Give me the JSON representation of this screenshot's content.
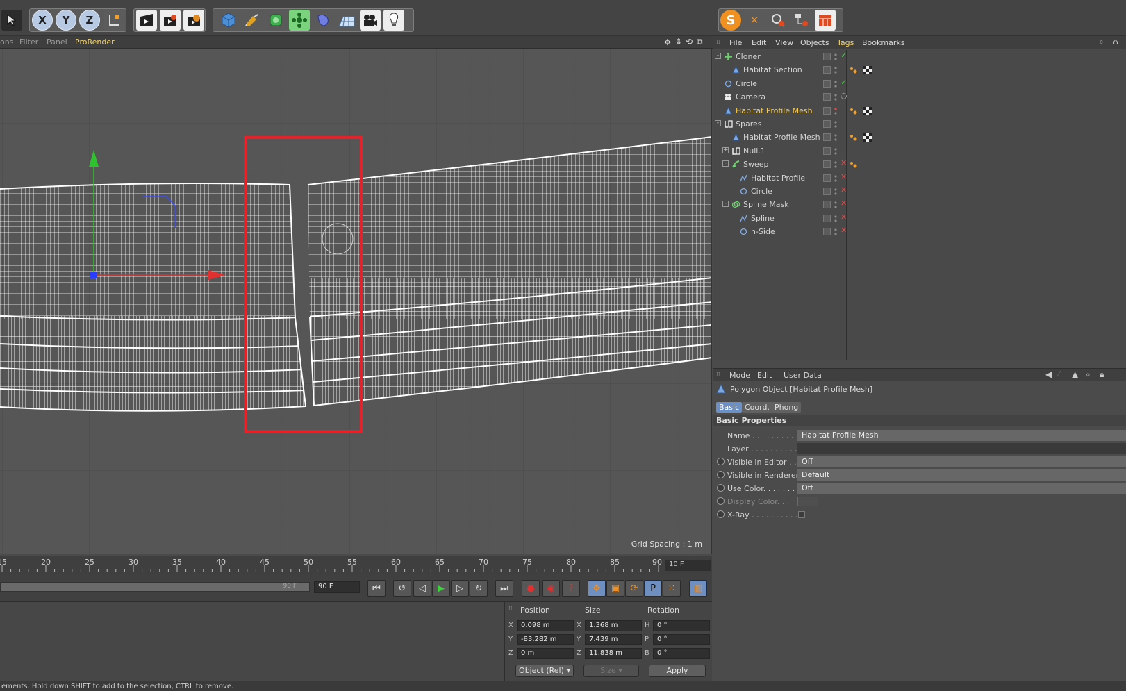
{
  "viewport": {
    "menus": [
      "ons",
      "Filter",
      "Panel",
      "ProRender"
    ],
    "active_menu": "ProRender",
    "grid_spacing": "Grid Spacing : 1 m"
  },
  "timeline": {
    "ticks": [
      "15",
      "20",
      "25",
      "30",
      "35",
      "40",
      "45",
      "50",
      "55",
      "60",
      "65",
      "70",
      "75",
      "80",
      "85",
      "90"
    ],
    "current_frame": "10 F",
    "end_frame_slider": "90 F",
    "end_frame_field": "90 F"
  },
  "coordinates": {
    "headers": {
      "position": "Position",
      "size": "Size",
      "rotation": "Rotation"
    },
    "rows": [
      {
        "axis": "X",
        "position": "0.098 m",
        "size_axis": "X",
        "size": "1.368 m",
        "rot_axis": "H",
        "rotation": "0 °"
      },
      {
        "axis": "Y",
        "position": "-83.282 m",
        "size_axis": "Y",
        "size": "7.439 m",
        "rot_axis": "P",
        "rotation": "0 °"
      },
      {
        "axis": "Z",
        "position": "0 m",
        "size_axis": "Z",
        "size": "11.838 m",
        "rot_axis": "B",
        "rotation": "0 °"
      }
    ],
    "mode_dropdown": "Object (Rel)",
    "size_dropdown": "Size",
    "apply_label": "Apply"
  },
  "status_text": "ements. Hold down SHIFT to add to the selection, CTRL to remove.",
  "object_manager": {
    "menus": [
      "File",
      "Edit",
      "View",
      "Objects",
      "Tags",
      "Bookmarks"
    ],
    "active_menu": "Tags",
    "objects": [
      {
        "name": "Cloner",
        "depth": 0,
        "expand": "-",
        "icon": "cloner",
        "status": "check",
        "tags": []
      },
      {
        "name": "Habitat Section",
        "depth": 1,
        "expand": "",
        "icon": "polygon",
        "status": "",
        "tags": [
          "phong",
          "texture"
        ]
      },
      {
        "name": "Circle",
        "depth": 0,
        "expand": "",
        "icon": "circle",
        "status": "check",
        "tags": []
      },
      {
        "name": "Camera",
        "depth": 0,
        "expand": "",
        "icon": "camera",
        "status": "target",
        "tags": []
      },
      {
        "name": "Habitat Profile Mesh",
        "depth": 0,
        "expand": "",
        "icon": "polygon",
        "status": "",
        "tags": [
          "phong",
          "texture"
        ],
        "selected": true
      },
      {
        "name": "Spares",
        "depth": 0,
        "expand": "-",
        "icon": "null",
        "status": "",
        "tags": []
      },
      {
        "name": "Habitat Profile Mesh",
        "depth": 1,
        "expand": "",
        "icon": "polygon",
        "status": "",
        "tags": [
          "phong",
          "texture"
        ]
      },
      {
        "name": "Null.1",
        "depth": 1,
        "expand": "+",
        "icon": "null",
        "status": "",
        "tags": []
      },
      {
        "name": "Sweep",
        "depth": 1,
        "expand": "-",
        "icon": "sweep",
        "status": "x",
        "tags": [
          "phong"
        ]
      },
      {
        "name": "Habitat Profile",
        "depth": 2,
        "expand": "",
        "icon": "spline",
        "status": "x",
        "tags": []
      },
      {
        "name": "Circle",
        "depth": 2,
        "expand": "",
        "icon": "circle",
        "status": "x",
        "tags": []
      },
      {
        "name": "Spline Mask",
        "depth": 1,
        "expand": "-",
        "icon": "splinemask",
        "status": "x",
        "tags": []
      },
      {
        "name": "Spline",
        "depth": 2,
        "expand": "",
        "icon": "spline",
        "status": "x",
        "tags": []
      },
      {
        "name": "n-Side",
        "depth": 2,
        "expand": "",
        "icon": "circle",
        "status": "x",
        "tags": []
      }
    ]
  },
  "attributes": {
    "menus": [
      "Mode",
      "Edit",
      "User Data"
    ],
    "title": "Polygon Object [Habitat Profile Mesh]",
    "tabs": [
      "Basic",
      "Coord.",
      "Phong"
    ],
    "active_tab": "Basic",
    "section": "Basic Properties",
    "rows": [
      {
        "label": "Name . . . . . . . . . . . .",
        "value": "Habitat Profile Mesh",
        "radio": false,
        "style": "field"
      },
      {
        "label": "Layer . . . . . . . . . . . .",
        "value": "",
        "radio": false,
        "style": "dark"
      },
      {
        "label": "Visible in Editor . .",
        "value": "Off",
        "radio": true,
        "style": "field"
      },
      {
        "label": "Visible in Renderer",
        "value": "Default",
        "radio": true,
        "style": "field"
      },
      {
        "label": "Use Color. . . . . . . . .",
        "value": "Off",
        "radio": true,
        "style": "field"
      },
      {
        "label": "Display Color. . .",
        "value": "",
        "radio": true,
        "style": "swatch"
      },
      {
        "label": "X-Ray . . . . . . . . . . .",
        "value": "",
        "radio": true,
        "style": "checkbox"
      }
    ]
  },
  "toolbar": {
    "axis_buttons": [
      "X",
      "Y",
      "Z"
    ]
  },
  "colors": {
    "accent_yellow": "#f3c94f",
    "selection_red": "#e8202a",
    "axis_green": "#2fc22f",
    "axis_red": "#e03030",
    "axis_blue": "#2a3cff"
  }
}
